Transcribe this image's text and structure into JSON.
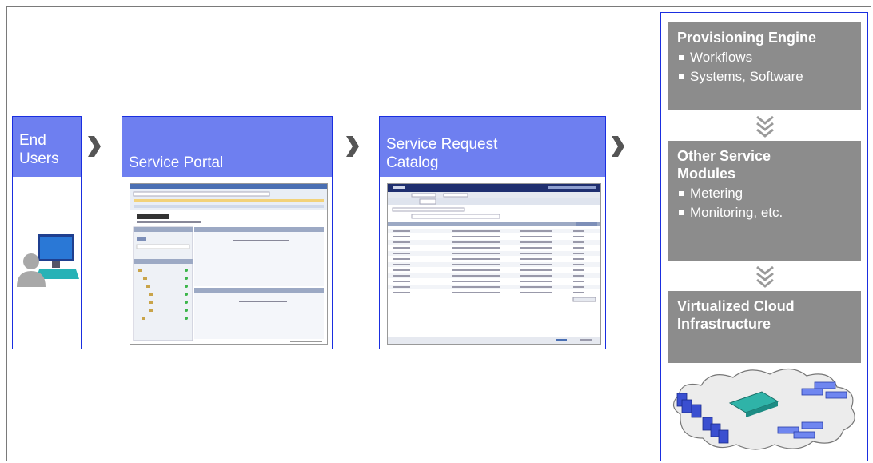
{
  "panels": {
    "end_users": {
      "title": "End\nUsers"
    },
    "service_portal": {
      "title": "Service Portal"
    },
    "service_request_catalog": {
      "title": "Service Request\nCatalog"
    }
  },
  "right_column": {
    "provisioning": {
      "title": "Provisioning Engine",
      "items": [
        "Workflows",
        "Systems, Software"
      ]
    },
    "other_modules": {
      "title": "Other Service\nModules",
      "items": [
        "Metering",
        "Monitoring, etc."
      ]
    },
    "virtualized": {
      "title": "Virtualized Cloud\nInfrastructure"
    }
  },
  "colors": {
    "panel_header": "#6e7ff0",
    "panel_border": "#1a2ee0",
    "gray_box": "#8c8c8c",
    "chevron": "#555555"
  }
}
